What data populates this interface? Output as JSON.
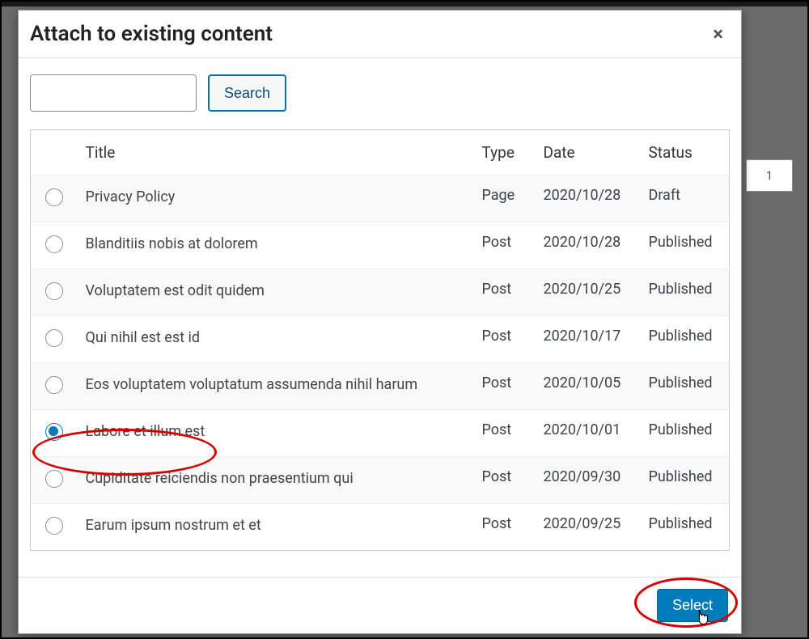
{
  "modal": {
    "title": "Attach to existing content",
    "close_label": "×",
    "search_button": "Search",
    "select_button": "Select",
    "columns": {
      "title": "Title",
      "type": "Type",
      "date": "Date",
      "status": "Status"
    },
    "rows": [
      {
        "title": "Privacy Policy",
        "type": "Page",
        "date": "2020/10/28",
        "status": "Draft",
        "selected": false
      },
      {
        "title": "Blanditiis nobis at dolorem",
        "type": "Post",
        "date": "2020/10/28",
        "status": "Published",
        "selected": false
      },
      {
        "title": "Voluptatem est odit quidem",
        "type": "Post",
        "date": "2020/10/25",
        "status": "Published",
        "selected": false
      },
      {
        "title": "Qui nihil est est id",
        "type": "Post",
        "date": "2020/10/17",
        "status": "Published",
        "selected": false
      },
      {
        "title": "Eos voluptatem voluptatum assumenda nihil harum",
        "type": "Post",
        "date": "2020/10/05",
        "status": "Published",
        "selected": false
      },
      {
        "title": "Labore et illum est",
        "type": "Post",
        "date": "2020/10/01",
        "status": "Published",
        "selected": true
      },
      {
        "title": "Cupiditate reiciendis non praesentium qui",
        "type": "Post",
        "date": "2020/09/30",
        "status": "Published",
        "selected": false
      },
      {
        "title": "Earum ipsum nostrum et et",
        "type": "Post",
        "date": "2020/09/25",
        "status": "Published",
        "selected": false
      }
    ]
  },
  "background": {
    "page_number": "1"
  }
}
